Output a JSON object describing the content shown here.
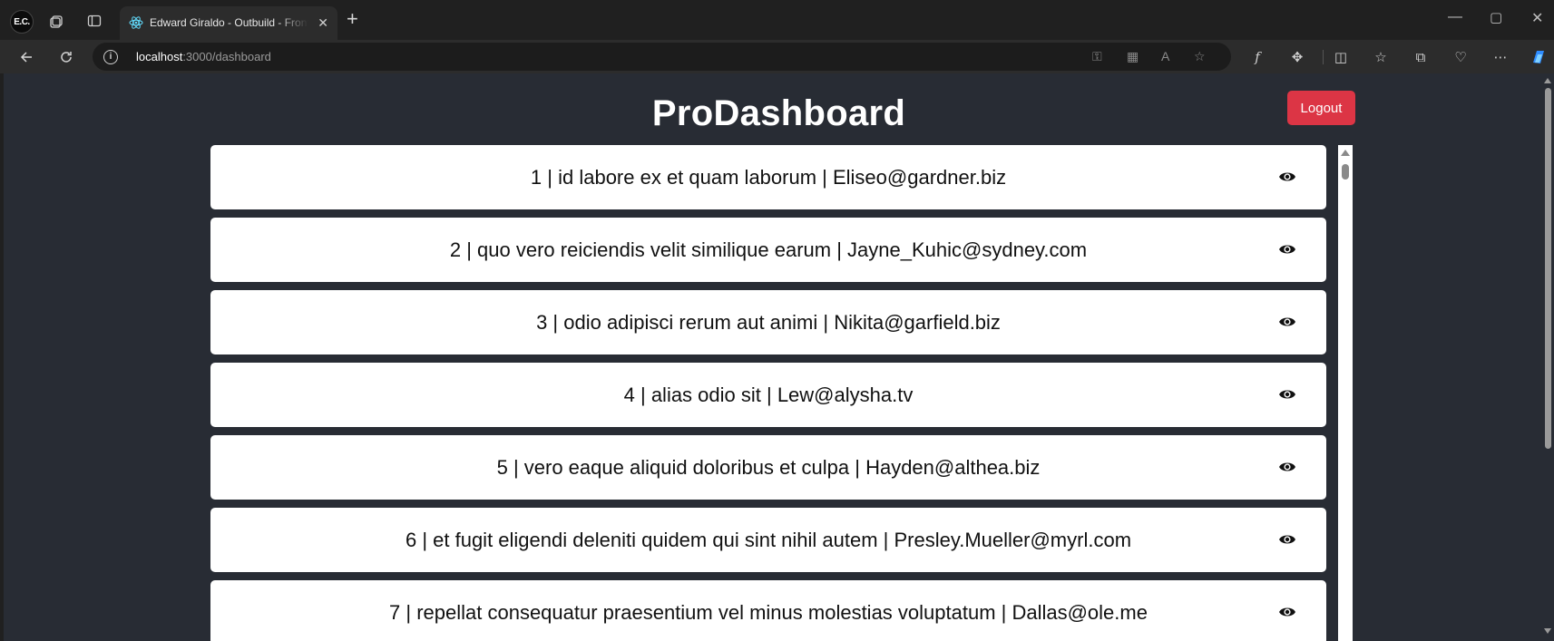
{
  "browser": {
    "profile_initials": "E.C.",
    "tab_title": "Edward Giraldo - Outbuild - Front",
    "url_host": "localhost",
    "url_path": ":3000/dashboard"
  },
  "page": {
    "title": "ProDashboard",
    "logout_label": "Logout"
  },
  "items": [
    {
      "text": "1 | id labore ex et quam laborum | Eliseo@gardner.biz"
    },
    {
      "text": "2 | quo vero reiciendis velit similique earum | Jayne_Kuhic@sydney.com"
    },
    {
      "text": "3 | odio adipisci rerum aut animi | Nikita@garfield.biz"
    },
    {
      "text": "4 | alias odio sit | Lew@alysha.tv"
    },
    {
      "text": "5 | vero eaque aliquid doloribus et culpa | Hayden@althea.biz"
    },
    {
      "text": "6 | et fugit eligendi deleniti quidem qui sint nihil autem | Presley.Mueller@myrl.com"
    },
    {
      "text": "7 | repellat consequatur praesentium vel minus molestias voluptatum | Dallas@ole.me"
    }
  ],
  "colors": {
    "page_bg": "#282c34",
    "logout_bg": "#dc3545",
    "card_bg": "#ffffff"
  },
  "icons": {
    "item_action": "eye-icon"
  }
}
